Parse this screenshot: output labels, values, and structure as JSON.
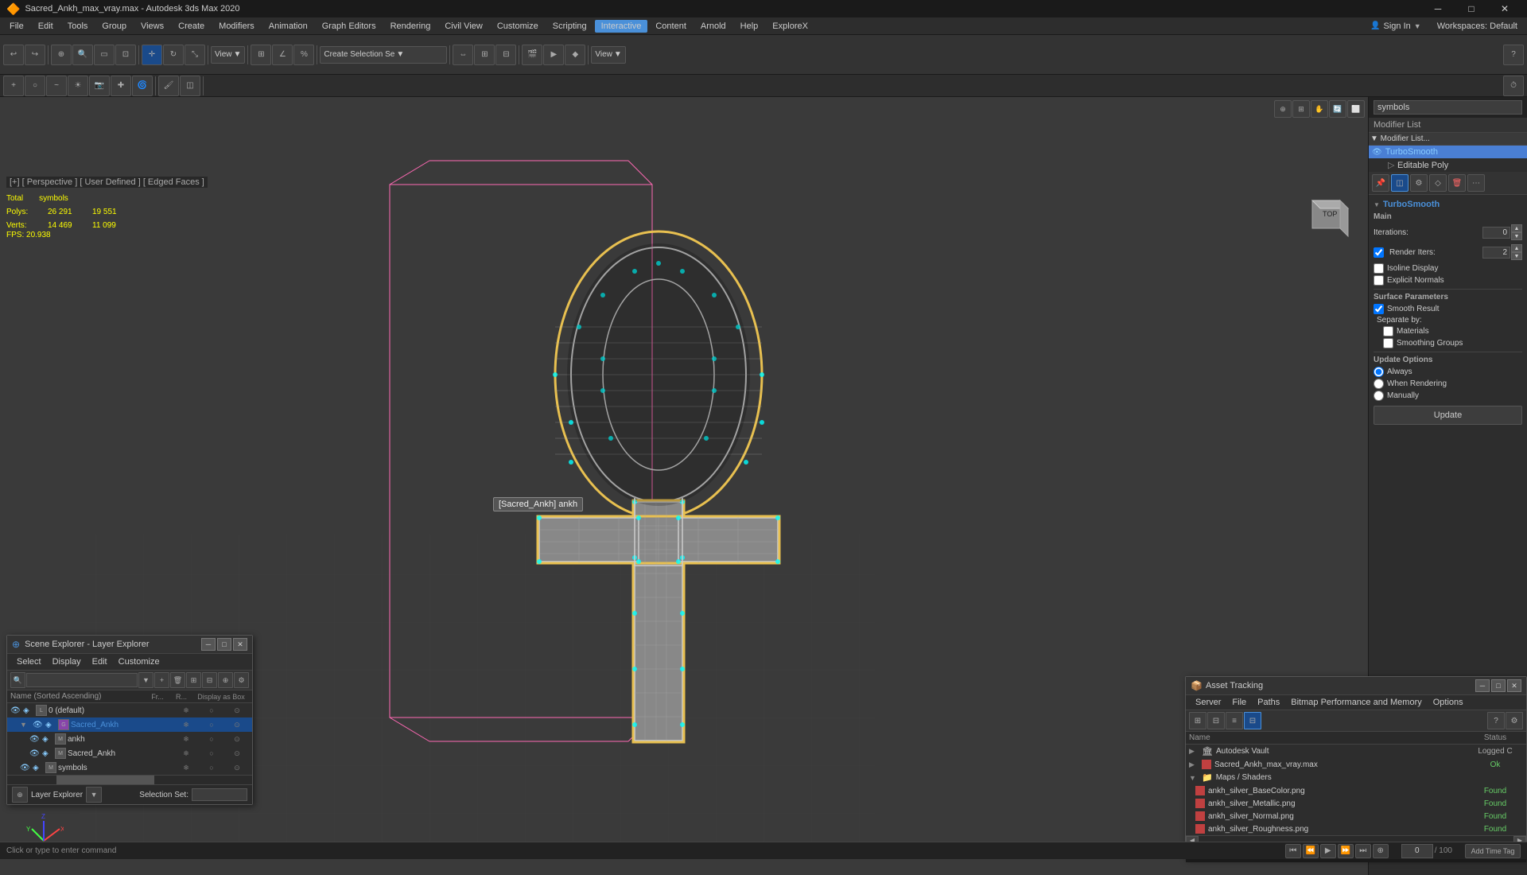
{
  "window": {
    "title": "Sacred_Ankh_max_vray.max - Autodesk 3ds Max 2020",
    "app_icon": "3dsmax"
  },
  "title_bar": {
    "title": "Sacred_Ankh_max_vray.max - Autodesk 3ds Max 2020",
    "min": "─",
    "max": "□",
    "close": "✕"
  },
  "menu_bar": {
    "items": [
      "File",
      "Edit",
      "Tools",
      "Group",
      "Views",
      "Create",
      "Modifiers",
      "Animation",
      "Graph Editors",
      "Rendering",
      "Civil View",
      "Customize",
      "Scripting",
      "Interactive",
      "Content",
      "Arnold",
      "Help",
      "ExploreX"
    ]
  },
  "toolbar": {
    "interactive_label": "Interactive",
    "create_selection_label": "Create Selection Se",
    "view_label": "View",
    "sign_in": "Sign In",
    "workspaces": "Workspaces: Default"
  },
  "viewport": {
    "label": "[+] [ Perspective ] [ User Defined ] [ Edged Faces ]",
    "stats": {
      "total_label": "Total",
      "symbols_label": "symbols",
      "polys_label": "Polys:",
      "polys_total": "26 291",
      "polys_symbols": "19 551",
      "verts_label": "Verts:",
      "verts_total": "14 469",
      "verts_symbols": "11 099"
    },
    "fps_label": "FPS:",
    "fps_value": "20.938",
    "tooltip": "[Sacred_Ankh] ankh"
  },
  "right_panel": {
    "search_placeholder": "symbols",
    "modifier_list_header": "Modifier List",
    "modifiers": [
      {
        "name": "TurboSmooth",
        "selected": true
      },
      {
        "name": "Editable Poly",
        "selected": false
      }
    ],
    "turbosmooth": {
      "title": "TurboSmooth",
      "main_label": "Main",
      "iterations_label": "Iterations:",
      "iterations_value": "0",
      "render_iters_label": "Render Iters:",
      "render_iters_value": "2",
      "isoline_display": "Isoline Display",
      "explicit_normals": "Explicit Normals",
      "surface_params_label": "Surface Parameters",
      "smooth_result": "Smooth Result",
      "separate_by_label": "Separate by:",
      "materials": "Materials",
      "smoothing_groups": "Smoothing Groups",
      "update_options_label": "Update Options",
      "always": "Always",
      "when_rendering": "When Rendering",
      "manually": "Manually",
      "update_btn": "Update"
    }
  },
  "scene_explorer": {
    "title": "Scene Explorer - Layer Explorer",
    "menu_items": [
      "Select",
      "Display",
      "Edit",
      "Customize"
    ],
    "columns": [
      "Name (Sorted Ascending)",
      "Fr...",
      "R...",
      "Display as Box"
    ],
    "rows": [
      {
        "name": "0 (default)",
        "level": 0,
        "type": "layer"
      },
      {
        "name": "Sacred_Ankh",
        "level": 1,
        "type": "group",
        "selected": true
      },
      {
        "name": "ankh",
        "level": 2,
        "type": "mesh"
      },
      {
        "name": "Sacred_Ankh",
        "level": 2,
        "type": "mesh"
      },
      {
        "name": "symbols",
        "level": 1,
        "type": "mesh"
      }
    ],
    "footer_layer": "Layer Explorer",
    "footer_selection": "Selection Set:"
  },
  "asset_tracking": {
    "title": "Asset Tracking",
    "menu_items": [
      "Server",
      "File",
      "Paths",
      "Bitmap Performance and Memory",
      "Options"
    ],
    "columns": [
      "Name",
      "Status"
    ],
    "vault_row": "Autodesk Vault",
    "vault_status": "Logged C",
    "file_row": "Sacred_Ankh_max_vray.max",
    "file_status": "Ok",
    "maps_label": "Maps / Shaders",
    "files": [
      {
        "name": "ankh_silver_BaseColor.png",
        "status": "Found"
      },
      {
        "name": "ankh_silver_Metallic.png",
        "status": "Found"
      },
      {
        "name": "ankh_silver_Normal.png",
        "status": "Found"
      },
      {
        "name": "ankh_silver_Roughness.png",
        "status": "Found"
      }
    ]
  },
  "status_bar": {
    "label": "Add Time Tag"
  }
}
